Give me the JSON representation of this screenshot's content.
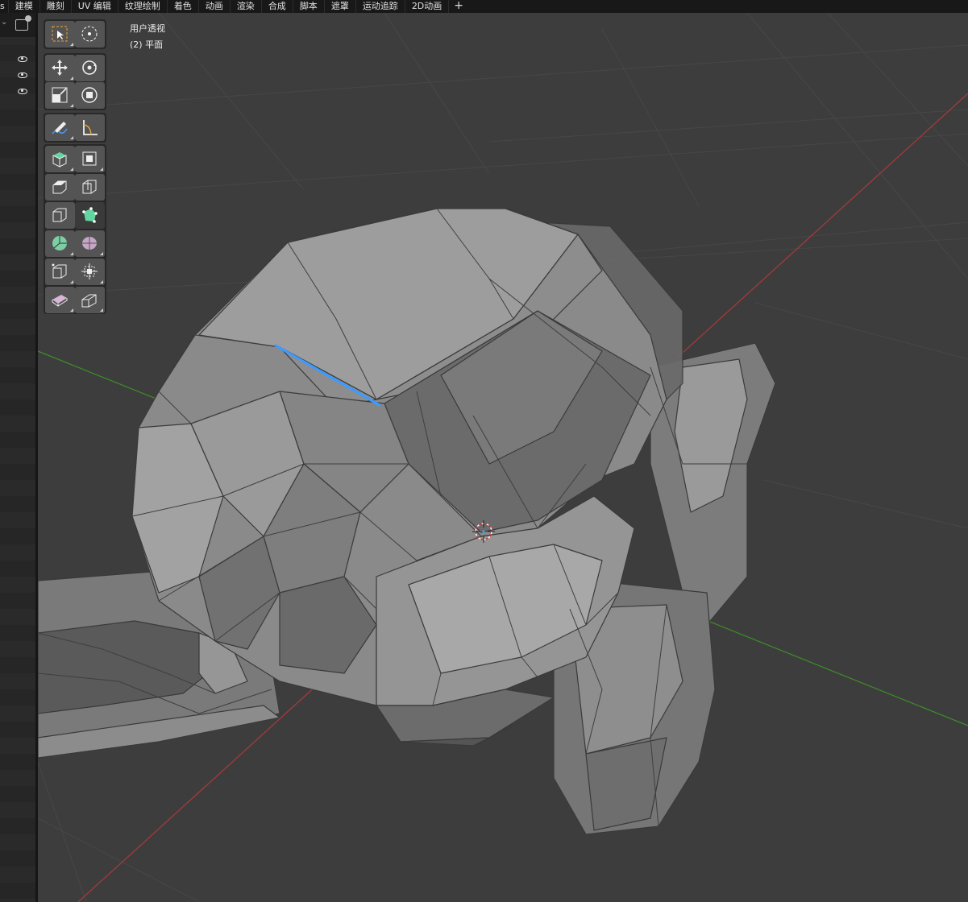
{
  "topbar": {
    "tabs": [
      "s",
      "建模",
      "雕刻",
      "UV 编辑",
      "纹理绘制",
      "着色",
      "动画",
      "渲染",
      "合成",
      "脚本",
      "遮罩",
      "运动追踪",
      "2D动画"
    ],
    "add_symbol": "+"
  },
  "viewport": {
    "view_name": "用户透视",
    "object_label": "(2) 平面"
  },
  "outliner": {
    "visibility_icons": [
      "eye-icon",
      "eye-icon",
      "eye-icon"
    ]
  },
  "toolbar": {
    "tools": [
      "select-box-icon",
      "cursor-icon",
      "move-icon",
      "rotate-icon",
      "scale-icon",
      "transform-icon",
      "annotate-icon",
      "measure-icon",
      "add-cube-icon",
      "extrude-region-icon",
      "inset-faces-icon",
      "bevel-icon",
      "loop-cut-icon",
      "knife-icon",
      "poly-build-icon",
      "spin-icon",
      "smooth-icon",
      "edge-slide-icon",
      "shrink-fatten-icon",
      "shear-icon"
    ],
    "active_tool": "knife-icon"
  },
  "colors": {
    "background": "#3d3d3d",
    "x_axis": "#a33a3a",
    "y_axis": "#3c8a2a",
    "selected_edge": "#3d9bff",
    "active_tool_accent": "#62d6a0"
  }
}
